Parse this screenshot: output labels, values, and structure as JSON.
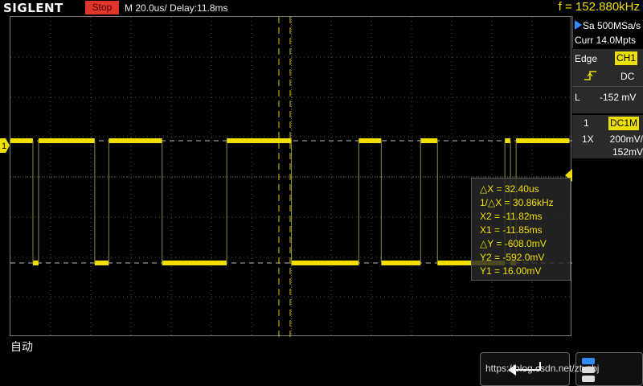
{
  "header": {
    "brand": "SIGLENT",
    "run_state": "Stop",
    "timebase": "M 20.0us/  Delay:11.8ms",
    "frequency": "f = 152.880kHz"
  },
  "side_panel": {
    "sample_rate": "Sa 500MSa/s",
    "memory_depth": "Curr 14.0Mpts",
    "trigger_type": "Edge",
    "trigger_source": "CH1",
    "trigger_coupling": "DC",
    "trigger_level_label": "L",
    "trigger_level": "-152 mV",
    "channel_number": "1",
    "channel_coupling": "DC1M",
    "probe": "1X",
    "volts_div": "200mV/",
    "offset": "152mV"
  },
  "cursors": {
    "delta_x": "△X = 32.40us",
    "inv_delta_x": "1/△X = 30.86kHz",
    "x2": "X2 = -11.82ms",
    "x1": "X1 = -11.85ms",
    "delta_y": "△Y = -608.0mV",
    "y2": "Y2 = -592.0mV",
    "y1": "Y1 = 16.00mV"
  },
  "ch1_marker": "1",
  "trigger_mode": "自动",
  "watermark": "https://blog.csdn.net/ztvzbj",
  "colors": {
    "trace": "#f0e000",
    "stop_badge": "#e0352b",
    "grid": "#555555",
    "cursor_line": "#e0c000"
  },
  "waveform": {
    "high_segments": [
      [
        0.0,
        0.04
      ],
      [
        0.05,
        0.15
      ],
      [
        0.175,
        0.27
      ],
      [
        0.385,
        0.5
      ],
      [
        0.62,
        0.66
      ],
      [
        0.73,
        0.76
      ],
      [
        0.88,
        0.89
      ],
      [
        0.9,
        0.995
      ]
    ],
    "low_segments": [
      [
        0.04,
        0.05
      ],
      [
        0.15,
        0.175
      ],
      [
        0.27,
        0.385
      ],
      [
        0.5,
        0.62
      ],
      [
        0.66,
        0.73
      ],
      [
        0.76,
        0.88
      ],
      [
        0.89,
        0.9
      ]
    ]
  }
}
